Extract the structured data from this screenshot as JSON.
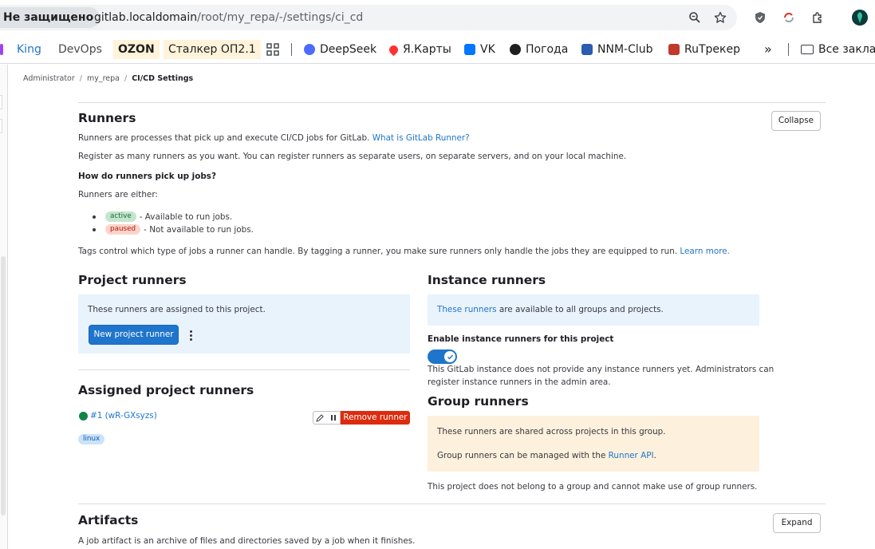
{
  "browser": {
    "security_label": "Не защищено",
    "url_host": "gitlab.localdomain",
    "url_path": "/root/my_repa/-/settings/ci_cd"
  },
  "bookmarks": {
    "items": [
      "King",
      "DevOps",
      "OZON",
      "Сталкер ОП2.1",
      "DeepSeek",
      "Я.Карты",
      "VK",
      "Погода",
      "NNM-Club",
      "RuТрекер"
    ],
    "more": "»",
    "all_bookmarks": "Все закла"
  },
  "breadcrumb": {
    "items": [
      "Administrator",
      "my_repa",
      "CI/CD Settings"
    ],
    "separator": "/"
  },
  "runners": {
    "title": "Runners",
    "collapse_label": "Collapse",
    "intro": "Runners are processes that pick up and execute CI/CD jobs for GitLab.",
    "intro_link": "What is GitLab Runner?",
    "register_text": "Register as many runners as you want. You can register runners as separate users, on separate servers, and on your local machine.",
    "how_heading": "How do runners pick up jobs?",
    "either_text": "Runners are either:",
    "active_badge": "active",
    "active_desc": "- Available to run jobs.",
    "paused_badge": "paused",
    "paused_desc": "- Not available to run jobs.",
    "tags_text": "Tags control which type of jobs a runner can handle. By tagging a runner, you make sure runners only handle the jobs they are equipped to run.",
    "tags_link": "Learn more."
  },
  "project_runners": {
    "title": "Project runners",
    "panel_text": "These runners are assigned to this project.",
    "new_button": "New project runner"
  },
  "assigned_runners": {
    "title": "Assigned project runners",
    "runner_name": "#1 (wR-GXsyzs)",
    "tag": "linux",
    "remove_button": "Remove runner"
  },
  "instance_runners": {
    "title": "Instance runners",
    "panel_link": "These runners",
    "panel_text": " are available to all groups and projects.",
    "toggle_label": "Enable instance runners for this project",
    "toggle_on": true,
    "note_line1": "This GitLab instance does not provide any instance runners yet. Administrators can",
    "note_line2": "register instance runners in the admin area."
  },
  "group_runners": {
    "title": "Group runners",
    "panel_line1": "These runners are shared across projects in this group.",
    "panel_line2": "Group runners can be managed with the ",
    "panel_link": "Runner API",
    "panel_end": ".",
    "footer_text": "This project does not belong to a group and cannot make use of group runners."
  },
  "artifacts": {
    "title": "Artifacts",
    "expand_label": "Expand",
    "desc": "A job artifact is an archive of files and directories saved by a job when it finishes."
  },
  "colors": {
    "primary": "#1f75cb",
    "danger": "#dd2b0e",
    "success": "#108548",
    "info_panel": "#e9f3fc",
    "warning_panel": "#fdf1dd"
  }
}
